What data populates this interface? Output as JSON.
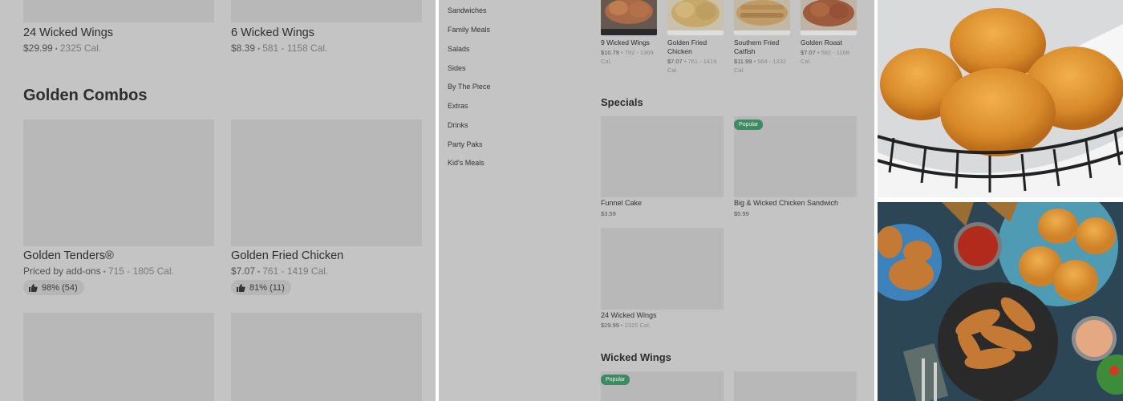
{
  "left_panel": {
    "top_items": [
      {
        "name": "24 Wicked Wings",
        "price": "$29.99",
        "cal": "2325 Cal."
      },
      {
        "name": "6 Wicked Wings",
        "price": "$8.39",
        "cal": "581 - 1158 Cal."
      }
    ],
    "section_title": "Golden Combos",
    "combo_items": [
      {
        "name": "Golden Tenders®",
        "price": "Priced by add-ons",
        "cal": "715 - 1805 Cal.",
        "rating": "98% (54)"
      },
      {
        "name": "Golden Fried Chicken",
        "price": "$7.07",
        "cal": "761 - 1419 Cal.",
        "rating": "81% (11)"
      }
    ]
  },
  "middle_panel": {
    "categories": [
      "Sandwiches",
      "Family Meals",
      "Salads",
      "Sides",
      "By The Piece",
      "Extras",
      "Drinks",
      "Party Paks",
      "Kid's Meals"
    ],
    "carousel": [
      {
        "name_line1": "9 Wicked Wings",
        "name_line2": "",
        "price": "$10.79",
        "cal_a": "792 - 1369",
        "cal_b": "Cal."
      },
      {
        "name_line1": "Golden Fried",
        "name_line2": "Chicken",
        "price": "$7.07",
        "cal_a": "761 - 1419",
        "cal_b": "Cal."
      },
      {
        "name_line1": "Southern Fried",
        "name_line2": "Catfish",
        "price": "$11.99",
        "cal_a": "564 - 1332",
        "cal_b": "Cal."
      },
      {
        "name_line1": "Golden Roast",
        "name_line2": "",
        "price": "$7.07",
        "cal_a": "582 - 1168",
        "cal_b": "Cal."
      }
    ],
    "specials_title": "Specials",
    "specials": [
      {
        "name": "Funnel Cake",
        "price": "$3.59",
        "badge": ""
      },
      {
        "name": "Big & Wicked Chicken Sandwich",
        "price": "$5.99",
        "badge": "Popular"
      },
      {
        "name": "24 Wicked Wings",
        "price": "$29.99",
        "cal": "2325 Cal.",
        "badge": ""
      }
    ],
    "wings_title": "Wicked Wings",
    "wings_badge": "Popular"
  },
  "colors": {
    "overlay_gray": "#c4c4c4",
    "placeholder_gray": "#b8b8b8",
    "popular_badge": "#3e8a63"
  }
}
